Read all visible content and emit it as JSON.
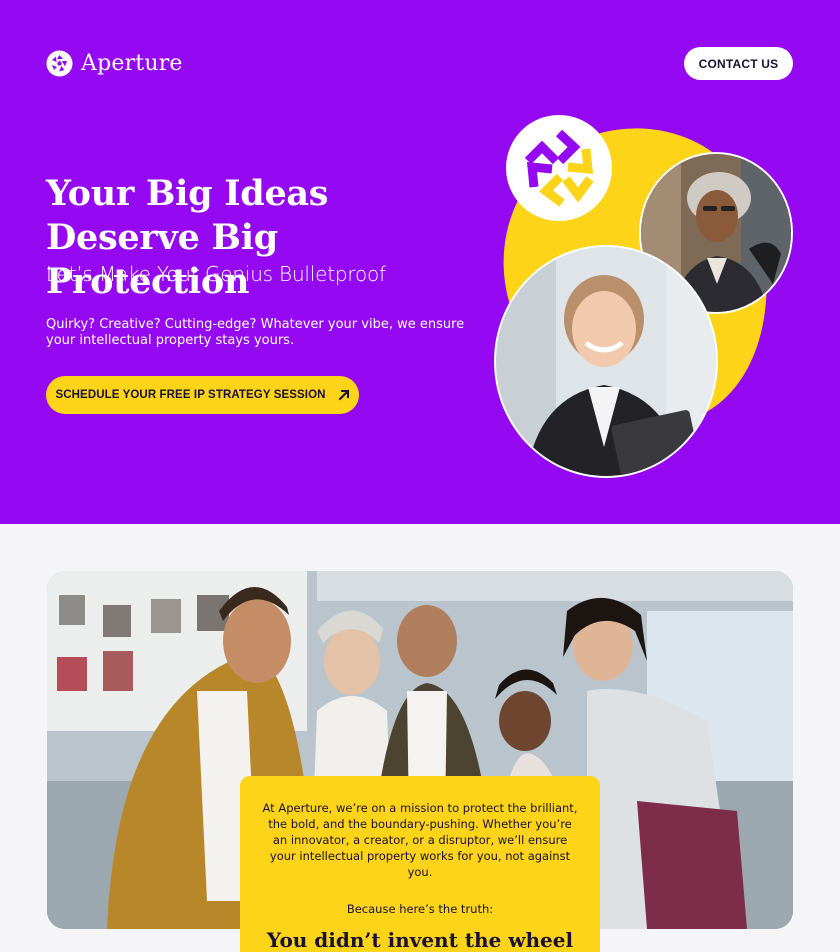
{
  "brand": {
    "name": "Aperture"
  },
  "nav": {
    "contact_label": "CONTACT US"
  },
  "hero": {
    "title": "Your Big Ideas Deserve Big Protection",
    "subtitle": "Let’s Make Your Genius Bulletproof",
    "body": "Quirky? Creative? Cutting-edge? Whatever your vibe, we ensure your intellectual property stays yours.",
    "cta_label": "SCHEDULE YOUR FREE IP STRATEGY SESSION"
  },
  "mission": {
    "text": "At Aperture, we’re on a mission to protect the brilliant, the bold, and the boundary-pushing. Whether you’re an innovator, a creator, or a disruptor, we’ll ensure your intellectual property works for you, not against you.",
    "intro": "Because here’s the truth:",
    "headline": "You didn’t invent the wheel"
  },
  "colors": {
    "primary": "#9409f2",
    "accent": "#fdd418",
    "ink": "#1a1036"
  }
}
